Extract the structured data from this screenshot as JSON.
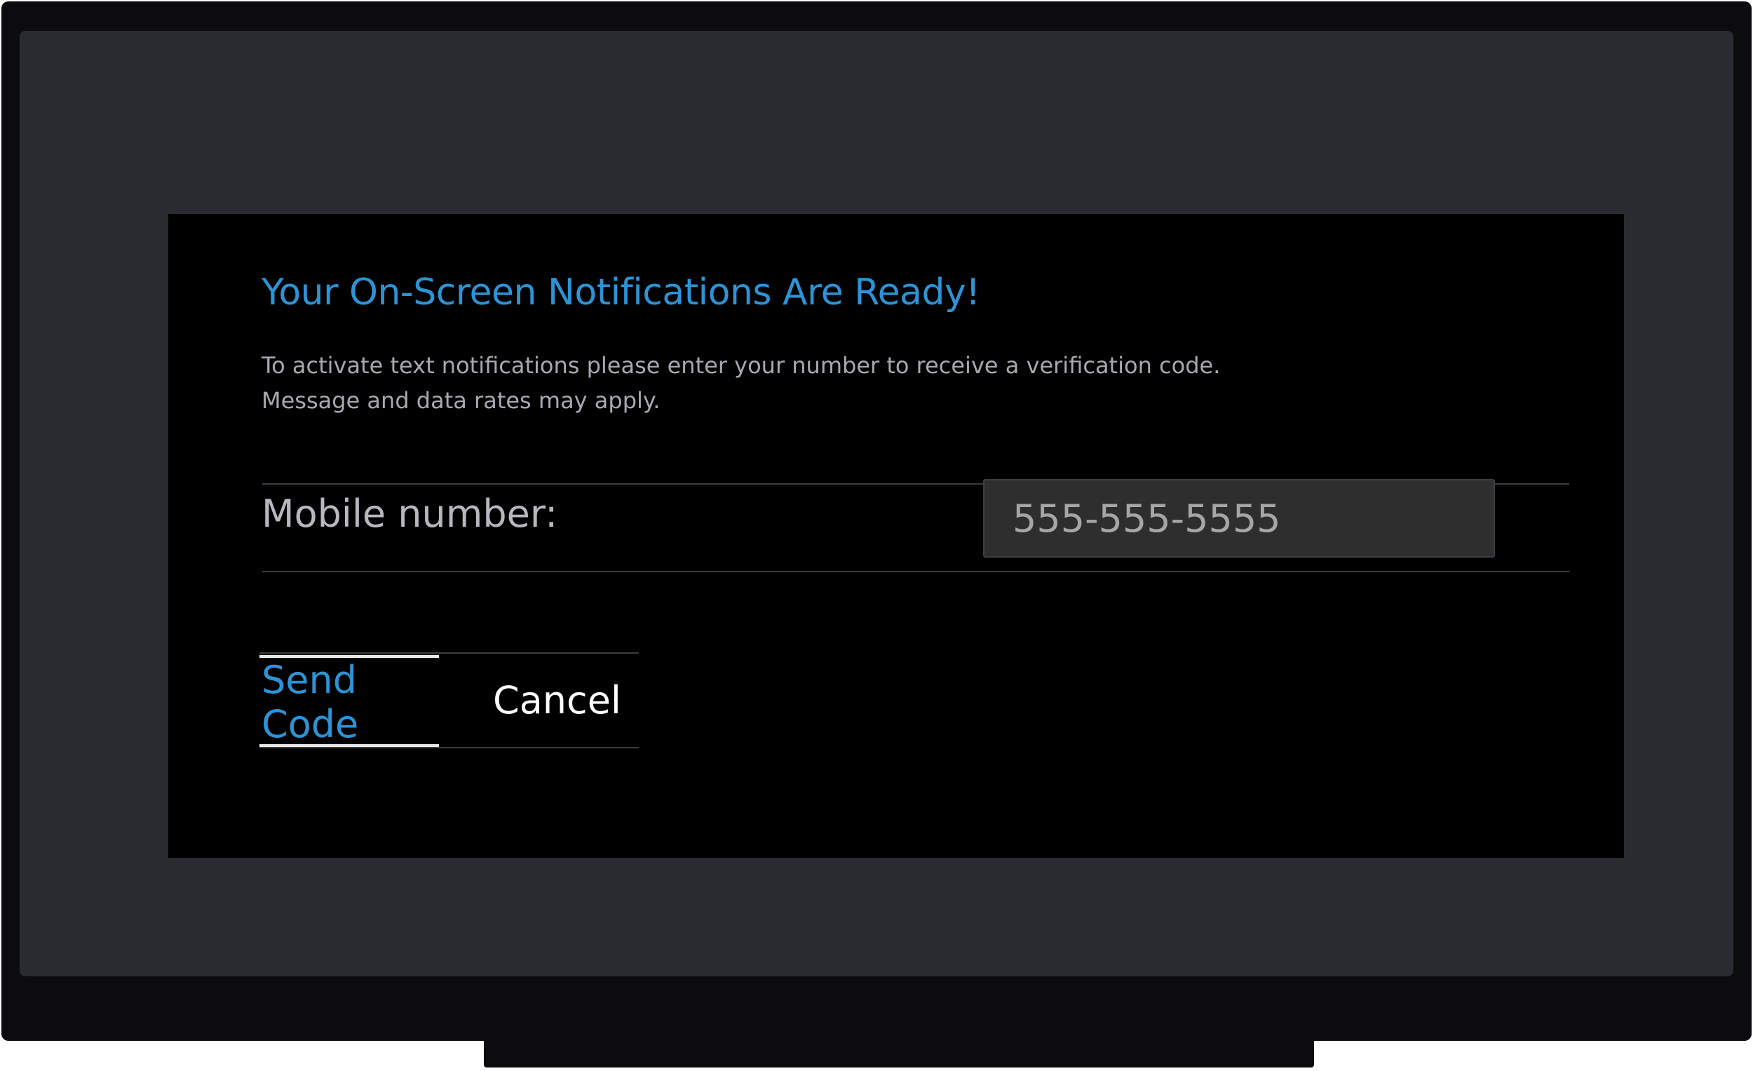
{
  "dialog": {
    "title": "Your On-Screen Notifications Are Ready!",
    "message_line_1": "To activate text notifications please enter your number to receive a verification code.",
    "message_line_2": "Message and data rates may apply.",
    "field_label": "Mobile number:",
    "mobile_input": {
      "placeholder": "555-555-5555",
      "value": ""
    },
    "send_button_label": "Send Code",
    "cancel_button_label": "Cancel"
  },
  "colors": {
    "accent": "#2c94d6",
    "dialog_background": "#000000",
    "screen_background": "#2a2a31",
    "bezel": "#0c0c0f",
    "focus_indicator": "#e8e8e8"
  },
  "focus": "send_button"
}
